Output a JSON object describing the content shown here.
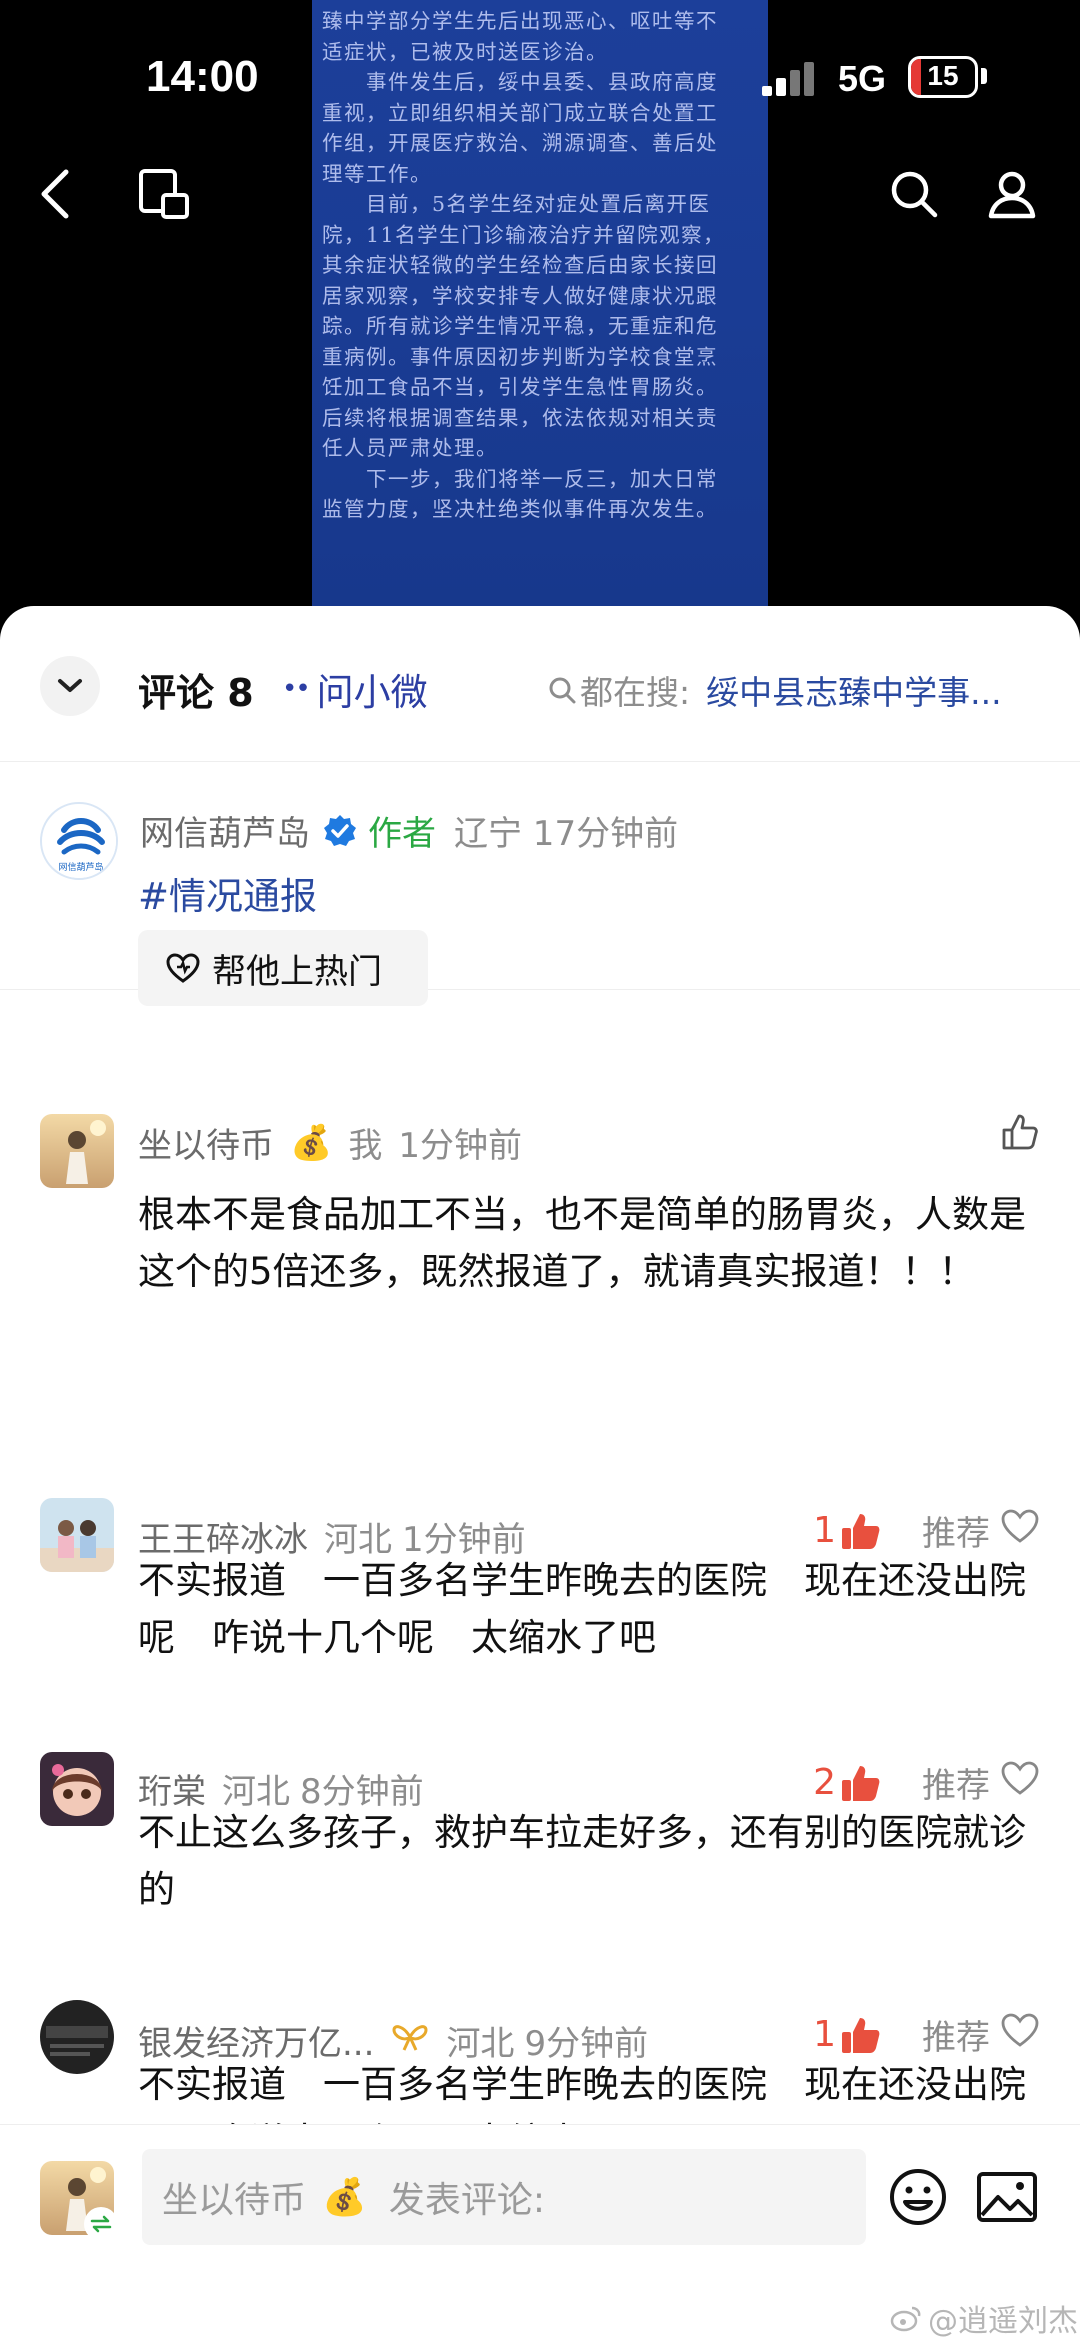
{
  "status_bar": {
    "time": "14:00",
    "network": "5G",
    "battery": "15",
    "battery_level": 0.15
  },
  "nav": {
    "back_icon": "back-arrow-icon",
    "window_icon": "floating-window-icon",
    "search_icon": "search-icon",
    "profile_icon": "person-icon"
  },
  "document_image": {
    "text": "臻中学部分学生先后出现恶心、呕吐等不\n适症状，已被及时送医诊治。\n　　事件发生后，绥中县委、县政府高度\n重视，立即组织相关部门成立联合处置工\n作组，开展医疗救治、溯源调查、善后处\n理等工作。\n　　目前，5名学生经对症处置后离开医\n院，11名学生门诊输液治疗并留院观察，\n其余症状轻微的学生经检查后由家长接回\n居家观察，学校安排专人做好健康状况跟\n踪。所有就诊学生情况平稳，无重症和危\n重病例。事件原因初步判断为学校食堂烹\n饪加工食品不当，引发学生急性胃肠炎。\n后续将根据调查结果，依法依规对相关责\n任人员严肃处理。\n　　下一步，我们将举一反三，加大日常\n监管力度，坚决杜绝类似事件再次发生。"
  },
  "comment_header": {
    "title": "评论 8",
    "ask_ai": "问小微",
    "search_label": "都在搜:",
    "search_query": "绥中县志臻中学事..."
  },
  "author_post": {
    "username": "网信葫芦岛",
    "author_tag": "作者",
    "meta": "辽宁 17分钟前",
    "body": "#情况通报",
    "boost_label": "帮他上热门",
    "avatar_text": "网信葫芦岛"
  },
  "comments": [
    {
      "username": "坐以待币",
      "badge": "我",
      "meta": "1分钟前",
      "likes": "",
      "text": "根本不是食品加工不当，也不是简单的肠胃炎，人数是这个的5倍还多，既然报道了，就请真实报道！！！"
    },
    {
      "username": "王王碎冰冰",
      "region": "河北",
      "meta": "1分钟前",
      "likes": "1",
      "recommend": "推荐",
      "text": "不实报道　一百多名学生昨晚去的医院　现在还没出院呢　咋说十几个呢　太缩水了吧"
    },
    {
      "username": "珩棠",
      "region": "河北",
      "meta": "8分钟前",
      "likes": "2",
      "recommend": "推荐",
      "text": "不止这么多孩子，救护车拉走好多，还有别的医院就诊的"
    },
    {
      "username": "银发经济万亿...",
      "region": "河北",
      "meta": "9分钟前",
      "likes": "1",
      "recommend": "推荐",
      "text": "不实报道　一百多名学生昨晚去的医院　现在还没出院呢　咋说十几个呢　太缩水了吧"
    }
  ],
  "input_bar": {
    "me_name": "坐以待币",
    "placeholder": "发表评论:",
    "emoji_icon": "emoji-icon",
    "image_icon": "image-icon"
  },
  "watermark": "@逍遥刘杰",
  "colors": {
    "link_blue": "#2a4aa0",
    "author_green": "#2aa843",
    "like_red": "#e8503e",
    "doc_blue": "#1c3f9a"
  }
}
